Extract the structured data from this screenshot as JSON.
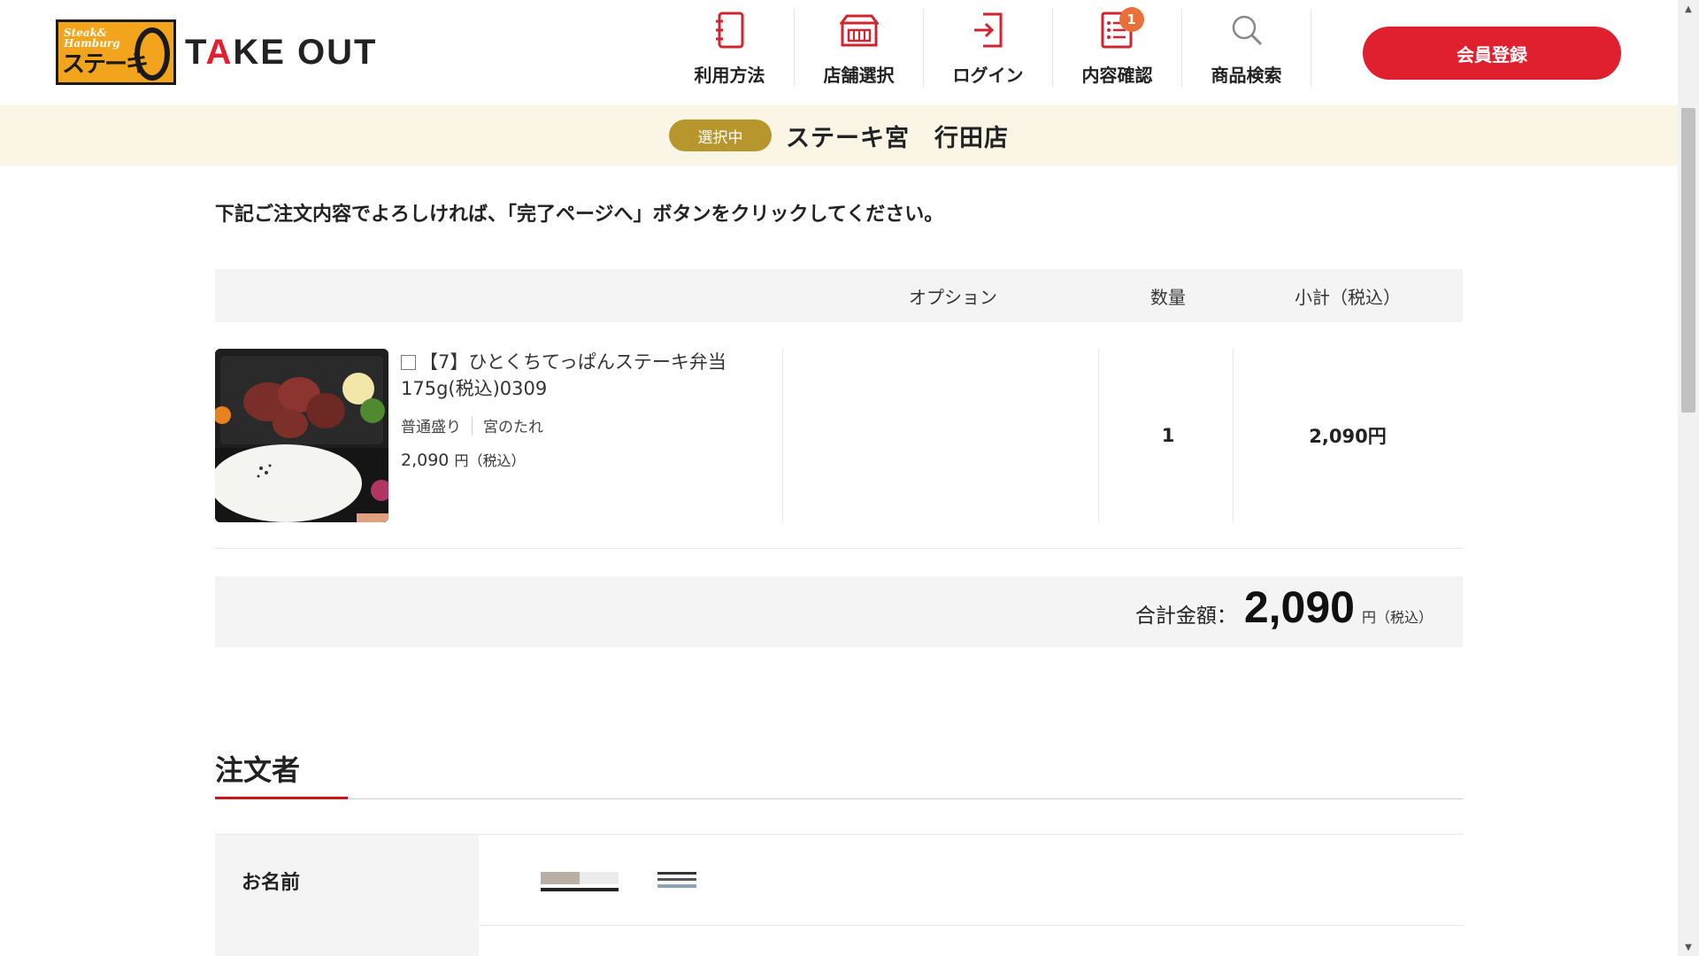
{
  "header": {
    "logo": {
      "badge_top": "Steak&\nHamburg",
      "badge_main": "ステーキ",
      "title_pre": "T",
      "title_accent": "A",
      "title_post": "KE OUT"
    },
    "nav": [
      {
        "label": "利用方法",
        "icon": "notebook-icon"
      },
      {
        "label": "店舗選択",
        "icon": "store-icon"
      },
      {
        "label": "ログイン",
        "icon": "login-icon"
      },
      {
        "label": "内容確認",
        "icon": "list-icon",
        "badge": "1"
      },
      {
        "label": "商品検索",
        "icon": "search-icon"
      }
    ],
    "register_label": "会員登録"
  },
  "store_bar": {
    "status": "選択中",
    "store_name": "ステーキ宮　行田店"
  },
  "main": {
    "instruction": "下記ご注文内容でよろしければ、「完了ページへ」ボタンをクリックしてください。",
    "table_headers": {
      "option": "オプション",
      "quantity": "数量",
      "subtotal": "小計（税込）"
    },
    "items": [
      {
        "title": "【7】ひとくちてっぱんステーキ弁当175g(税込)0309",
        "tags": [
          "普通盛り",
          "宮のたれ"
        ],
        "price": "2,090",
        "price_unit": "円",
        "price_tax": "（税込）",
        "option": "",
        "quantity": "1",
        "subtotal": "2,090円"
      }
    ],
    "total": {
      "label": "合計金額：",
      "value": "2,090",
      "unit": "円",
      "tax": "（税込）"
    }
  },
  "orderer": {
    "section_title": "注文者",
    "name_label": "お名前"
  },
  "colors": {
    "brand_red": "#e0202e",
    "gold": "#b8962e",
    "badge_orange": "#e8713a",
    "store_bar_bg": "#faf5e4"
  }
}
